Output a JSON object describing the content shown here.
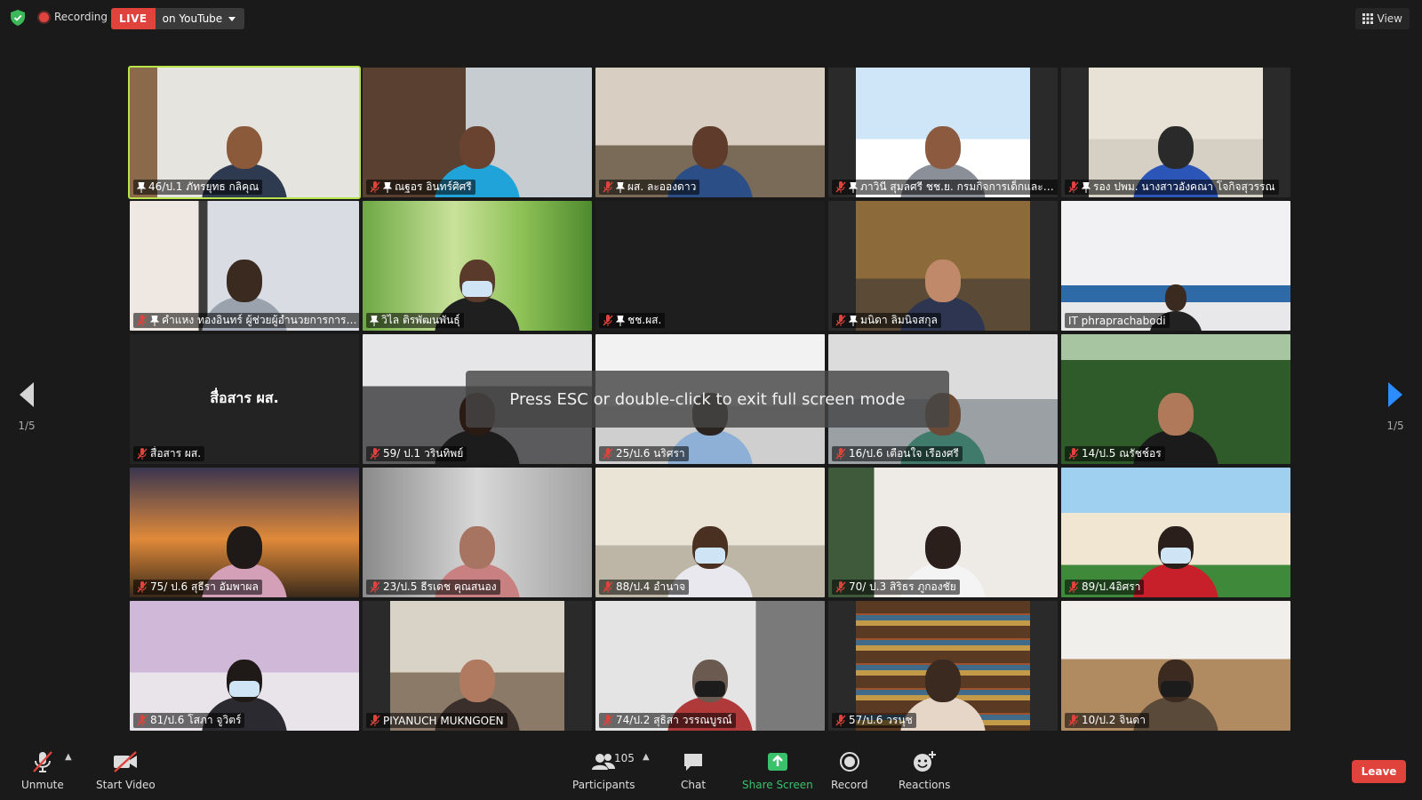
{
  "topbar": {
    "recording_label": "Recording",
    "live_badge": "LIVE",
    "live_target": "on YouTube",
    "view_label": "View"
  },
  "overlay": {
    "message": "Press ESC or double-click to exit full screen mode"
  },
  "pagination": {
    "left_page": "1/5",
    "right_page": "1/5"
  },
  "tiles": [
    {
      "name": "46/ป.1 ภัทรยุทธ กลิคุณ"
    },
    {
      "name": "ณฐอร อินทร์ศิศรี"
    },
    {
      "name": "ผส. ละอองดาว"
    },
    {
      "name": "ภาวินี สุมลศรี ชช.ย. กรมกิจการเด็กและเย..."
    },
    {
      "name": "รอง ปพม. นางสาวอังคณา โจกิจสุวรรณ"
    },
    {
      "name": "คำแหง ทองอินทร์ ผู้ช่วยผู้อำนวยการการเคหะ..."
    },
    {
      "name": "วิไล ติรพัฒนพันธุ์"
    },
    {
      "name": "ชช.ผส."
    },
    {
      "name": "มนิดา ลิมนิจสกุล"
    },
    {
      "name": "IT phraprachabodi"
    },
    {
      "name": "สื่อสาร ผส.",
      "center": "สื่อสาร ผส."
    },
    {
      "name": "59/ ป.1 วรินทิพย์"
    },
    {
      "name": "25/ป.6 นริศรา"
    },
    {
      "name": "16/ป.6 เตือนใจ เรืองศรี"
    },
    {
      "name": "14/ป.5 ณรัชช์อร"
    },
    {
      "name": "75/ ป.6 สุธีรา อัมพาผล"
    },
    {
      "name": "23/ป.5 ธีรเดช คุณสนอง"
    },
    {
      "name": "88/ป.4 อำนาจ"
    },
    {
      "name": "70/ ป.3 สิริธร ภูกองชัย"
    },
    {
      "name": "89/ป.4อิศรา"
    },
    {
      "name": "81/ป.6 โสภา จูวิตร์"
    },
    {
      "name": "PIYANUCH MUKNGOEN"
    },
    {
      "name": "74/ป.2 สุธิสา วรรณบูรณ์"
    },
    {
      "name": "57/ป.6 วรนุช"
    },
    {
      "name": "10/ป.2 จินดา"
    }
  ],
  "toolbar": {
    "unmute": "Unmute",
    "start_video": "Start Video",
    "participants_count": "105",
    "participants": "Participants",
    "chat": "Chat",
    "share_screen": "Share Screen",
    "record": "Record",
    "reactions": "Reactions",
    "leave": "Leave"
  },
  "colors": {
    "active_speaker": "#b9e34a",
    "live_red": "#e0433c",
    "share_green": "#39c16c"
  }
}
